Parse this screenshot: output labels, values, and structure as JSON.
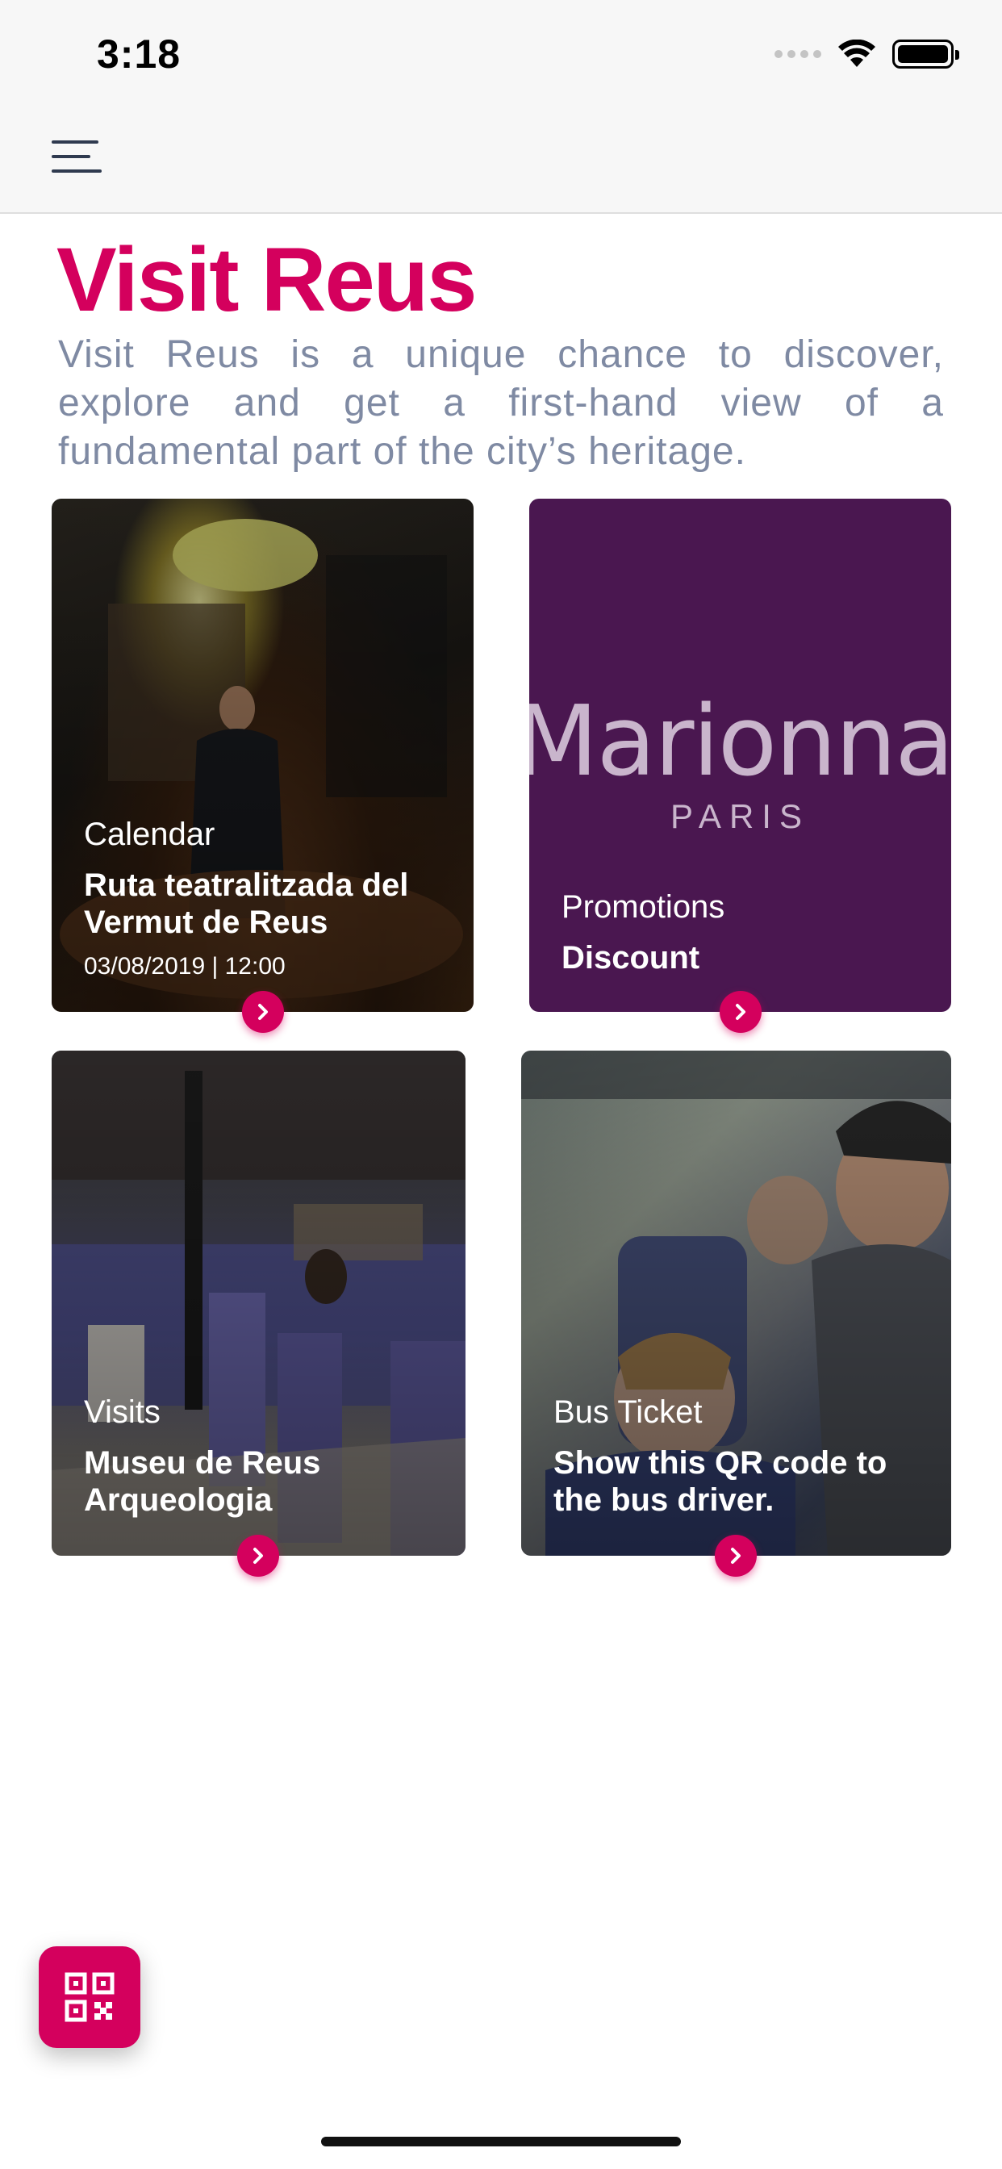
{
  "status_bar": {
    "time": "3:18"
  },
  "title": "Visit Reus",
  "intro": "Visit Reus is a unique chance to discover, explore and get a first-hand view of a fundamental part of the city’s heritage.",
  "cards": [
    {
      "category": "Calendar",
      "title": "Ruta teatralitzada del Vermut de Reus",
      "date": "03/08/2019 | 12:00"
    },
    {
      "category": "Promotions",
      "title": "Discount",
      "logo_text": "Marionnau",
      "logo_sub": "PARIS"
    },
    {
      "category": "Visits",
      "title": "Museu de Reus Arqueologia"
    },
    {
      "category": "Bus Ticket",
      "title": "Show this QR code to the bus driver."
    }
  ],
  "colors": {
    "accent": "#d4005d",
    "promo_bg": "#4a1750",
    "intro_text": "#7f8aa3"
  },
  "icons": {
    "menu": "menu-icon",
    "arrow": "chevron-right-icon",
    "qr": "qr-code-icon"
  }
}
